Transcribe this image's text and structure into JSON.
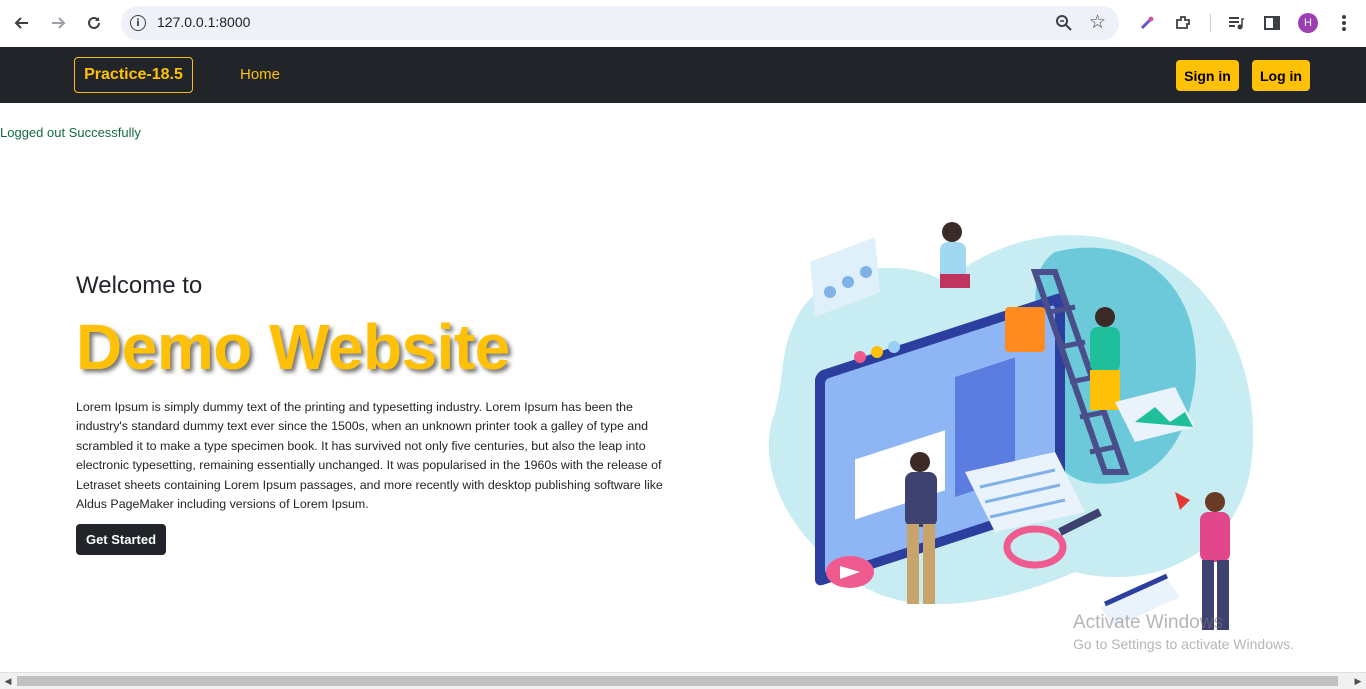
{
  "browser": {
    "url": "127.0.0.1:8000",
    "profile_initial": "H",
    "icons": [
      "back-arrow-icon",
      "forward-arrow-icon",
      "reload-icon",
      "info-icon",
      "zoom-icon",
      "star-icon",
      "eyedropper-icon",
      "extensions-icon",
      "media-icon",
      "sidepanel-icon",
      "menu-dots-icon"
    ]
  },
  "navbar": {
    "brand": "Practice-18.5",
    "home": "Home",
    "signin": "Sign in",
    "login": "Log in"
  },
  "alert": "Logged out Successfully",
  "hero": {
    "welcome": "Welcome to",
    "title": "Demo Website",
    "description": "Lorem Ipsum is simply dummy text of the printing and typesetting industry. Lorem Ipsum has been the industry's standard dummy text ever since the 1500s, when an unknown printer took a galley of type and scrambled it to make a type specimen book. It has survived not only five centuries, but also the leap into electronic typesetting, remaining essentially unchanged. It was popularised in the 1960s with the release of Letraset sheets containing Lorem Ipsum passages, and more recently with desktop publishing software like Aldus PageMaker including versions of Lorem Ipsum.",
    "cta": "Get Started"
  },
  "watermark": {
    "line1": "Activate Windows",
    "line2": "Go to Settings to activate Windows."
  },
  "colors": {
    "accent": "#ffc107",
    "navbar_bg": "#212529",
    "alert_text": "#146c43"
  }
}
